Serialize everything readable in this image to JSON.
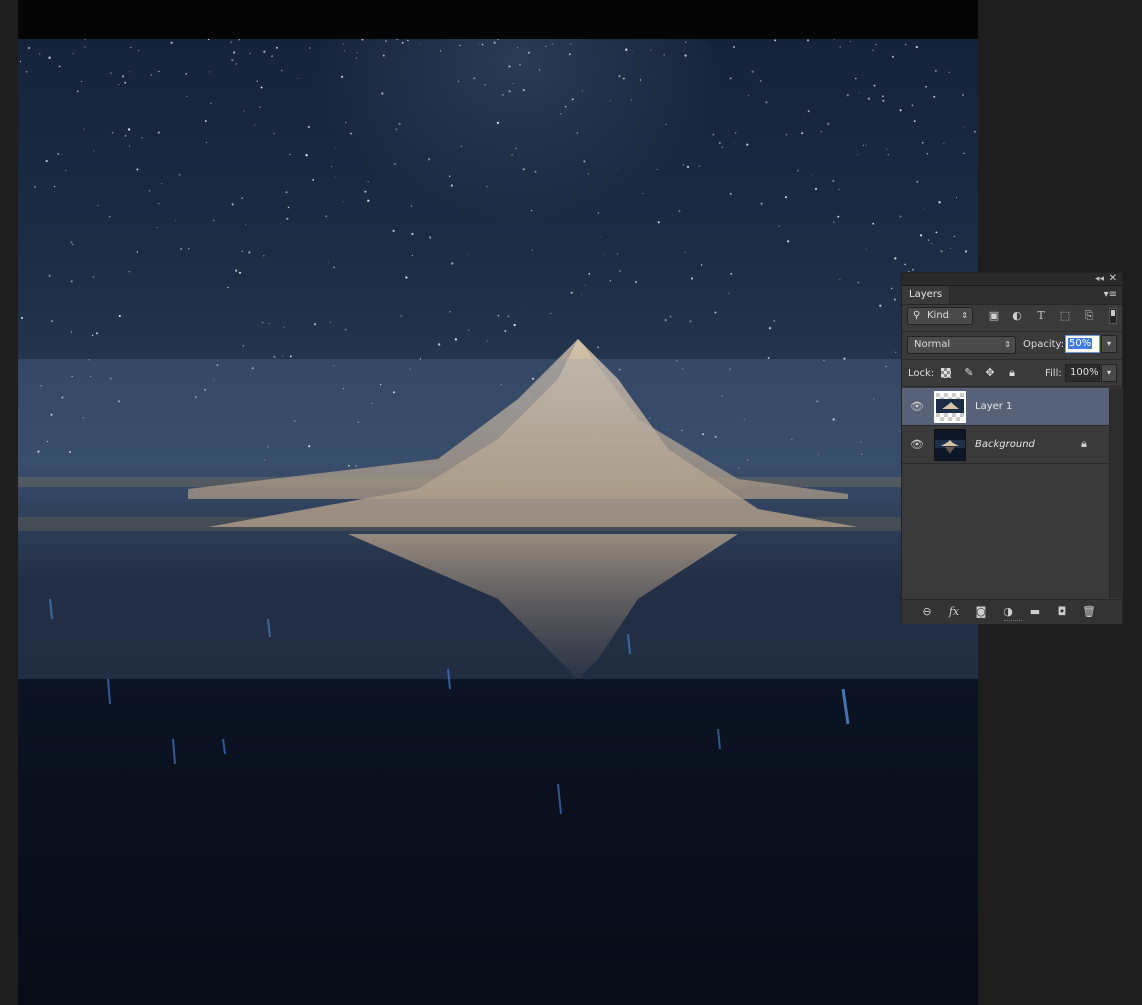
{
  "layers_panel": {
    "tab_label": "Layers",
    "collapse_icon": "double-chevron-left-icon",
    "close_icon": "close-icon",
    "menu_icon": "panel-menu-icon",
    "filter": {
      "kind_label": "Kind",
      "icons": [
        "image-filter-icon",
        "adjustment-filter-icon",
        "type-filter-icon",
        "shape-filter-icon",
        "smart-object-filter-icon"
      ]
    },
    "blend_mode": "Normal",
    "opacity_label": "Opacity:",
    "opacity_value": "50%",
    "lock_label": "Lock:",
    "fill_label": "Fill:",
    "fill_value": "100%",
    "layers": [
      {
        "name": "Layer 1",
        "selected": true,
        "visible": true,
        "locked": false
      },
      {
        "name": "Background",
        "selected": false,
        "visible": true,
        "locked": true
      }
    ],
    "footer_icons": [
      "link-layers-icon",
      "fx-icon",
      "add-mask-icon",
      "adjustment-layer-icon",
      "new-group-icon",
      "new-layer-icon",
      "delete-icon"
    ]
  },
  "colors": {
    "canvas_bg": "#1e1e1e",
    "panel_bg": "#3a3a3a",
    "selected_layer": "#576178",
    "highlight": "#3d7ee0"
  }
}
